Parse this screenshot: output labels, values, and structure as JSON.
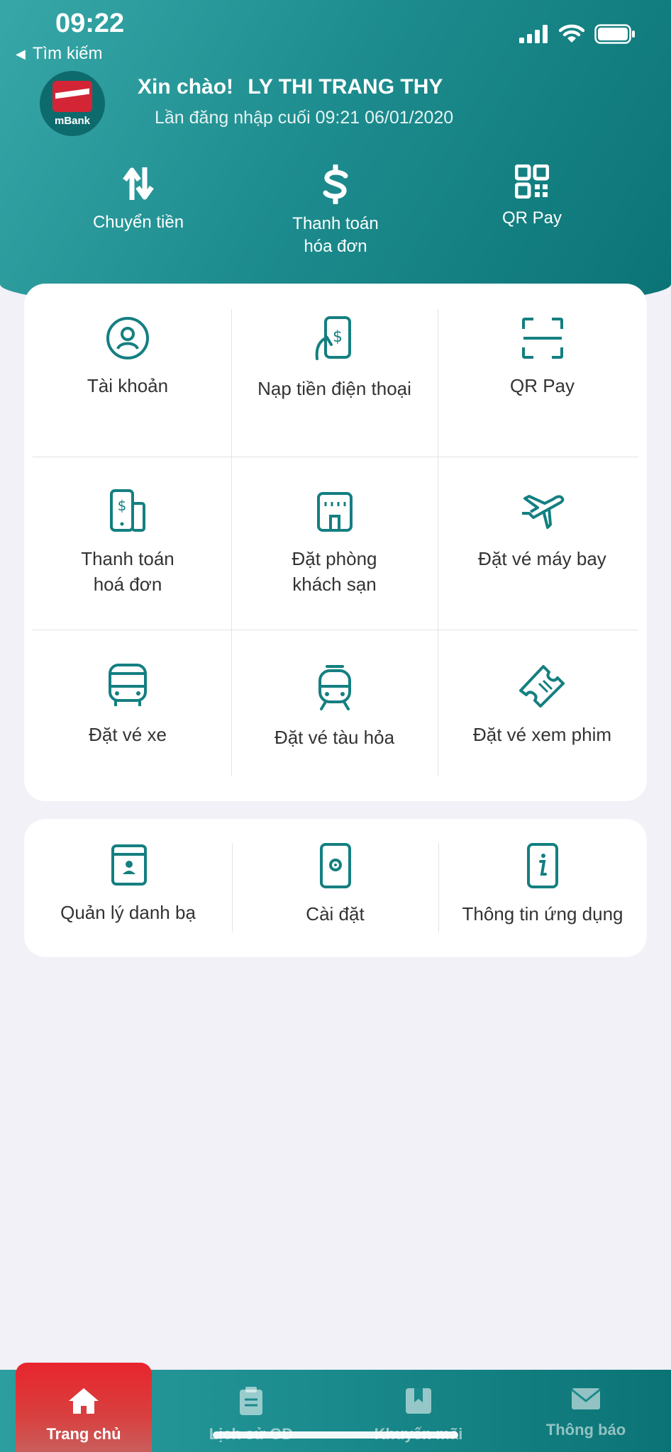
{
  "status_bar": {
    "time": "09:22",
    "back_label": "Tìm kiếm"
  },
  "header": {
    "logo_text": "mBank",
    "greeting_prefix": "Xin chào!",
    "user_name": "LY THI TRANG THY",
    "last_login": "Lần đăng nhập cuối 09:21 06/01/2020",
    "quick_actions": [
      {
        "label": "Chuyển tiền",
        "icon": "transfer-arrows-icon"
      },
      {
        "label_line1": "Thanh toán",
        "label_line2": "hóa đơn",
        "icon": "dollar-icon"
      },
      {
        "label": "QR Pay",
        "icon": "qr-code-icon"
      }
    ]
  },
  "services": [
    {
      "label": "Tài khoản",
      "icon": "account-icon"
    },
    {
      "label": "Nạp tiền điện thoại",
      "icon": "phone-topup-icon"
    },
    {
      "label": "QR Pay",
      "icon": "qr-scan-icon"
    },
    {
      "label_line1": "Thanh toán",
      "label_line2": "hoá đơn",
      "icon": "bill-payment-icon"
    },
    {
      "label_line1": "Đặt phòng",
      "label_line2": "khách sạn",
      "icon": "hotel-icon"
    },
    {
      "label": "Đặt vé máy bay",
      "icon": "airplane-icon"
    },
    {
      "label": "Đặt vé xe",
      "icon": "bus-icon"
    },
    {
      "label": "Đặt vé tàu hỏa",
      "icon": "train-icon"
    },
    {
      "label": "Đặt vé xem phim",
      "icon": "movie-ticket-icon"
    }
  ],
  "tools": [
    {
      "label": "Quản lý danh bạ",
      "icon": "contacts-icon"
    },
    {
      "label": "Cài đặt",
      "icon": "settings-icon"
    },
    {
      "label": "Thông tin ứng dụng",
      "icon": "info-icon"
    }
  ],
  "tabbar": [
    {
      "label": "Trang chủ",
      "icon": "home-icon",
      "active": true
    },
    {
      "label": "Lịch sử GD",
      "icon": "history-icon",
      "active": false
    },
    {
      "label": "Khuyến mãi",
      "icon": "promotion-icon",
      "active": false
    },
    {
      "label": "Thông báo",
      "icon": "mail-icon",
      "active": false
    }
  ],
  "colors": {
    "accent": "#147f81",
    "active_tab": "#e8252d",
    "background": "#f1f1f7"
  }
}
